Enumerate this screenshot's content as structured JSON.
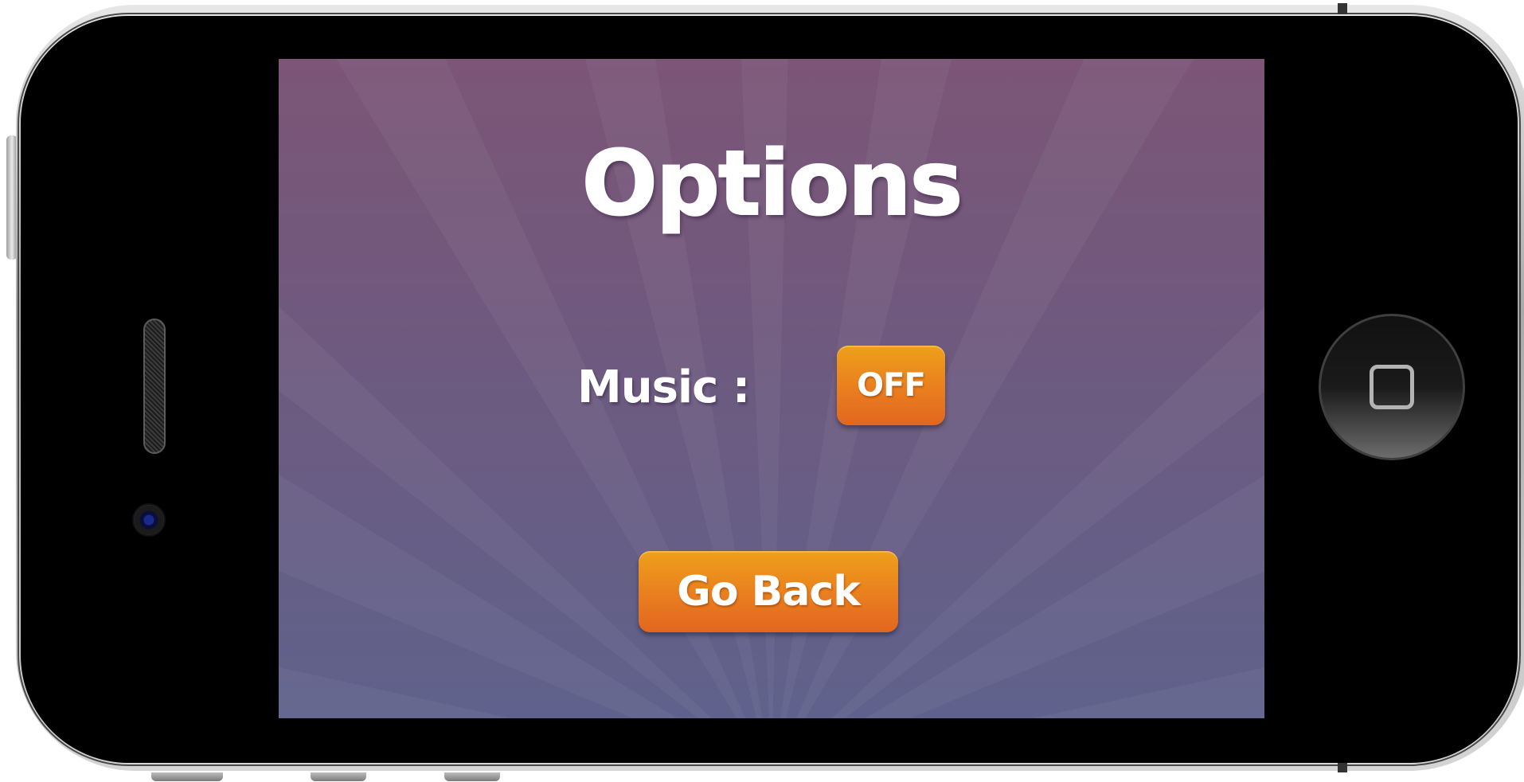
{
  "device": {
    "model_description": "",
    "home_button_icon": "home-square-icon"
  },
  "game_screen": {
    "title": "Options",
    "music": {
      "label": "Music :",
      "toggle_value": "OFF"
    },
    "go_back_label": "Go Back"
  },
  "colors": {
    "background_top": "#7c5577",
    "background_bottom": "#5f628c",
    "button_orange_top": "#eea01b",
    "button_orange_bottom": "#e2661f",
    "text": "#ffffff"
  }
}
